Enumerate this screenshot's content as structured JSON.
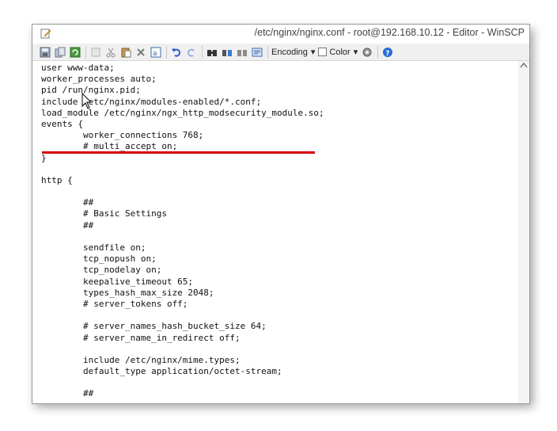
{
  "window": {
    "title": "/etc/nginx/nginx.conf - root@192.168.10.12 - Editor - WinSCP"
  },
  "toolbar": {
    "encoding_label": "Encoding",
    "color_label": "Color",
    "buttons": [
      "save-icon",
      "copy-icon",
      "reload-icon",
      "copy-disabled-icon",
      "cut-icon",
      "paste-icon",
      "delete-icon",
      "select-all-icon",
      "undo-icon",
      "redo-icon",
      "find-icon",
      "replace-icon",
      "find-next-icon",
      "goto-line-icon",
      "settings-icon",
      "help-icon"
    ]
  },
  "editor": {
    "lines": [
      "user www-data;",
      "worker_processes auto;",
      "pid /run/nginx.pid;",
      "include /etc/nginx/modules-enabled/*.conf;",
      "load_module /etc/nginx/ngx_http_modsecurity_module.so;",
      "events {",
      "        worker_connections 768;",
      "        # multi_accept on;",
      "}",
      "",
      "http {",
      "",
      "        ##",
      "        # Basic Settings",
      "        ##",
      "",
      "        sendfile on;",
      "        tcp_nopush on;",
      "        tcp_nodelay on;",
      "        keepalive_timeout 65;",
      "        types_hash_max_size 2048;",
      "        # server_tokens off;",
      "",
      "        # server_names_hash_bucket_size 64;",
      "        # server_name_in_redirect off;",
      "",
      "        include /etc/nginx/mime.types;",
      "        default_type application/octet-stream;",
      "",
      "        ##"
    ],
    "highlighted_line": 4,
    "highlight_color": "#d6000f"
  },
  "colors": {
    "accent_red": "#d6000f",
    "toolbar_bg": "#f0f0f0"
  }
}
